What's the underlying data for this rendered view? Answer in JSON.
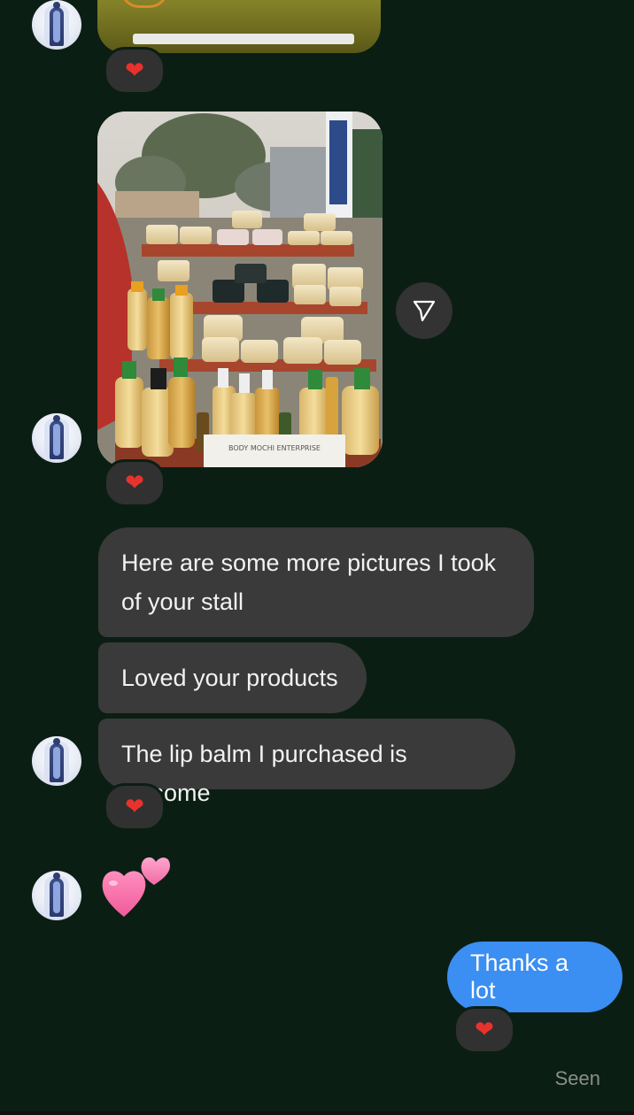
{
  "conversation": {
    "messages_in": [
      {
        "text": "Here are some more pictures I took of your stall"
      },
      {
        "text": "Loved your products"
      },
      {
        "text": "The lip balm I purchased is awsome"
      }
    ],
    "message_out": {
      "text": "Thanks a lot"
    },
    "reaction_emoji": "❤",
    "status": "Seen",
    "photo_sign_text": "BODY MOCHI ENTERPRISE"
  },
  "icons": {
    "share": "share-icon",
    "heart": "heart-icon",
    "two-hearts": "two-hearts-emoji-icon"
  },
  "colors": {
    "background": "#0b1e14",
    "incoming_bubble": "#3a3a3a",
    "outgoing_bubble": "#3b8ef2",
    "reaction_heart": "#e8322e"
  }
}
